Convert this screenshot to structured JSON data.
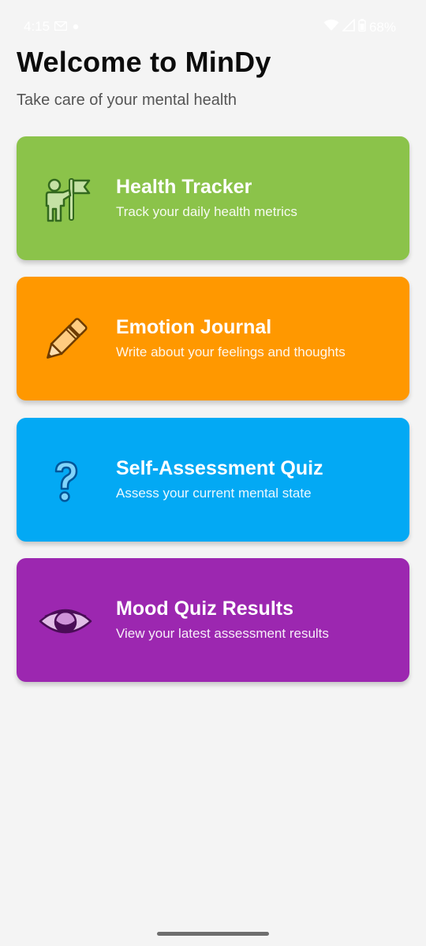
{
  "status_bar": {
    "time": "4:15",
    "battery": "68%"
  },
  "header": {
    "title": "Welcome to MinDy",
    "subtitle": "Take care of your mental health"
  },
  "cards": [
    {
      "title": "Health Tracker",
      "description": "Track your daily health metrics",
      "color": "#8bc34a",
      "icon": "person-flag-icon"
    },
    {
      "title": "Emotion Journal",
      "description": "Write about your feelings and thoughts",
      "color": "#ff9800",
      "icon": "pencil-icon"
    },
    {
      "title": "Self-Assessment Quiz",
      "description": "Assess your current mental state",
      "color": "#03a9f4",
      "icon": "question-mark-icon"
    },
    {
      "title": "Mood Quiz Results",
      "description": "View your latest assessment results",
      "color": "#9c27b0",
      "icon": "eye-icon"
    }
  ]
}
